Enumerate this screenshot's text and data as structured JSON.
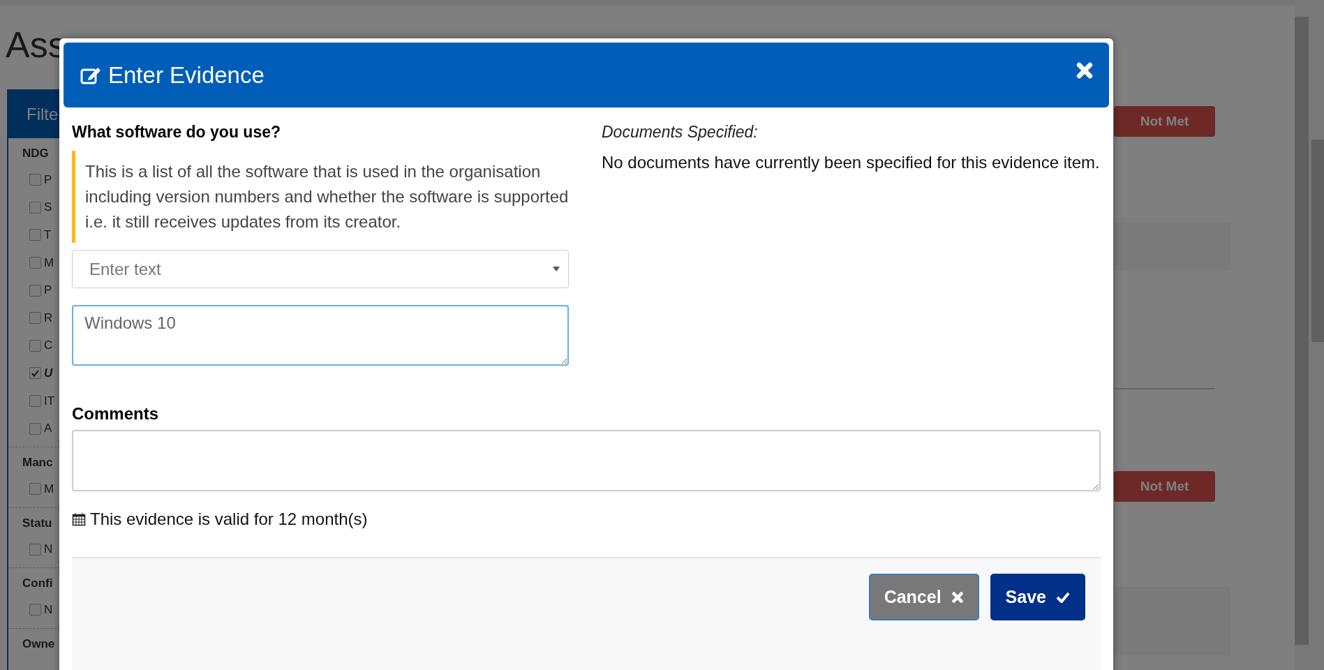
{
  "background": {
    "title": "Ass",
    "filter_header": "Filte",
    "sections": [
      {
        "label": "NDG",
        "items": [
          {
            "label": "P",
            "checked": false
          },
          {
            "label": "S",
            "checked": false
          },
          {
            "label": "T",
            "checked": false
          },
          {
            "label": "M",
            "checked": false
          },
          {
            "label": "P",
            "checked": false
          },
          {
            "label": "R",
            "checked": false
          },
          {
            "label": "C",
            "checked": false
          },
          {
            "label": "U",
            "checked": true
          },
          {
            "label": "IT",
            "checked": false
          },
          {
            "label": "A",
            "checked": false
          }
        ]
      },
      {
        "label": "Manc",
        "items": [
          {
            "label": "M",
            "checked": false
          }
        ]
      },
      {
        "label": "Statu",
        "items": [
          {
            "label": "N",
            "checked": false
          }
        ]
      },
      {
        "label": "Confi",
        "items": [
          {
            "label": "N",
            "checked": false
          }
        ]
      },
      {
        "label": "Owne"
      }
    ],
    "badges": [
      "Not Met",
      "Not Met"
    ]
  },
  "modal": {
    "title": "Enter Evidence",
    "question": "What software do you use?",
    "hint": "This is a list of all the software that is used in the organisation including version numbers and whether the software is supported i.e. it still receives updates from its creator.",
    "select_placeholder": "Enter text",
    "answer": "Windows 10",
    "documents_label": "Documents Specified:",
    "documents_text": "No documents have currently been specified for this evidence item.",
    "comments_label": "Comments",
    "validity": "This evidence is valid for 12 month(s)",
    "buttons": [
      {
        "label": "Cancel",
        "kind": "cancel"
      },
      {
        "label": "Save",
        "kind": "save"
      }
    ]
  }
}
